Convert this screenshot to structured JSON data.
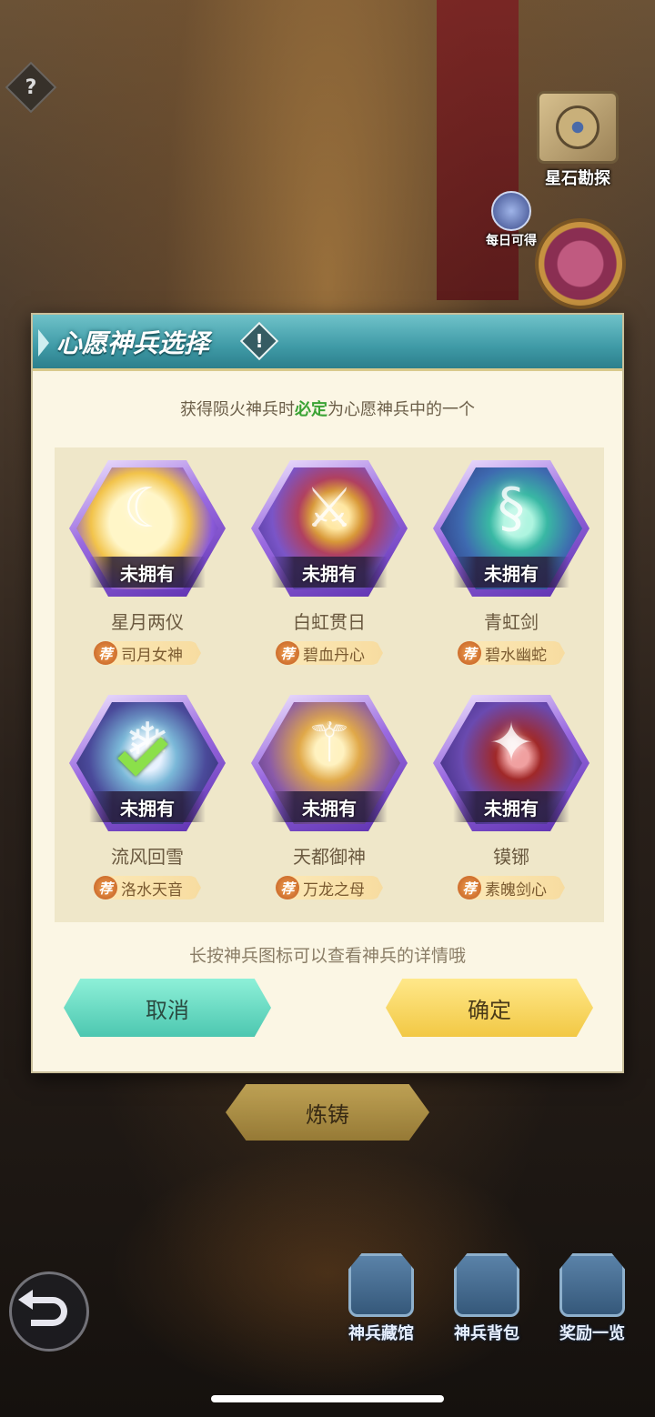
{
  "help": {
    "glyph": "?"
  },
  "side": {
    "explore_label": "星石勘探",
    "daily_label": "每日可得"
  },
  "dialog": {
    "title": "心愿神兵选择",
    "info_glyph": "!",
    "subtitle_before": "获得陨火神兵时",
    "subtitle_highlight": "必定",
    "subtitle_after": "为心愿神兵中的一个",
    "hint": "长按神兵图标可以查看神兵的详情哦",
    "cancel_label": "取消",
    "confirm_label": "确定",
    "rec_badge": "荐",
    "weapons": [
      {
        "status": "未拥有",
        "name": "星月两仪",
        "hero": "司月女神",
        "selected": false
      },
      {
        "status": "未拥有",
        "name": "白虹贯日",
        "hero": "碧血丹心",
        "selected": false
      },
      {
        "status": "未拥有",
        "name": "青虹剑",
        "hero": "碧水幽蛇",
        "selected": false
      },
      {
        "status": "未拥有",
        "name": "流风回雪",
        "hero": "洛水天音",
        "selected": true
      },
      {
        "status": "未拥有",
        "name": "天都御神",
        "hero": "万龙之母",
        "selected": false
      },
      {
        "status": "未拥有",
        "name": "镆铘",
        "hero": "素魄剑心",
        "selected": false
      }
    ]
  },
  "forge_label": "炼铸",
  "bottom_nav": [
    {
      "label": "神兵藏馆"
    },
    {
      "label": "神兵背包"
    },
    {
      "label": "奖励一览"
    }
  ],
  "colors": {
    "title_bar": "#3f9aa6",
    "highlight_green": "#3aa334",
    "cancel_btn": "#4cc7b0",
    "confirm_btn": "#f2c844"
  }
}
